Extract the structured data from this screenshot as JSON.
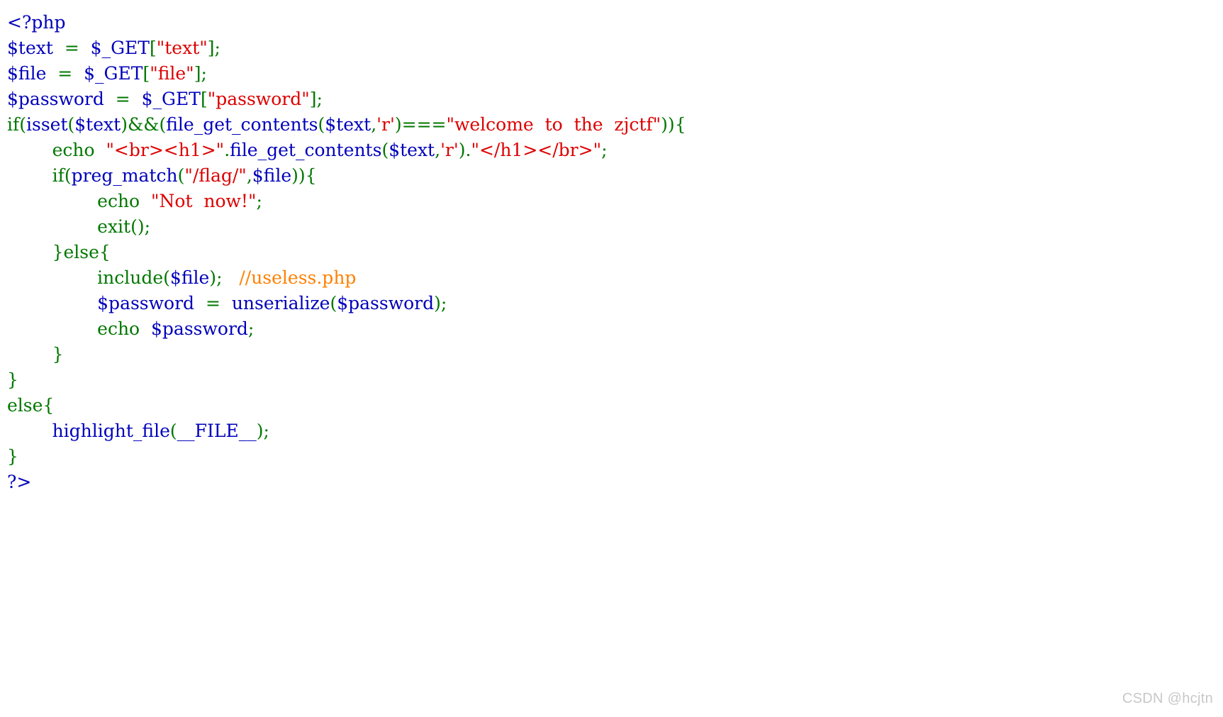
{
  "page": {
    "background_color": "#ffffff",
    "kind": "php-highlight-file-output"
  },
  "palette": {
    "default": "#0000BB",
    "keyword": "#007700",
    "string": "#DD0000",
    "comment": "#FF8000",
    "html": "#000000",
    "watermark": "#c8c8c8"
  },
  "code": {
    "language": "php",
    "lines": [
      {
        "index": 1,
        "text": "<?php",
        "tokens": [
          {
            "t": "<?php",
            "c": "default"
          }
        ]
      },
      {
        "index": 2,
        "text": "$text  =  $_GET[\"text\"];",
        "tokens": [
          {
            "t": "$text",
            "c": "default"
          },
          {
            "t": "  ",
            "c": "default"
          },
          {
            "t": "=",
            "c": "keyword"
          },
          {
            "t": "  ",
            "c": "default"
          },
          {
            "t": "$_GET",
            "c": "default"
          },
          {
            "t": "[",
            "c": "keyword"
          },
          {
            "t": "\"text\"",
            "c": "string"
          },
          {
            "t": "]",
            "c": "keyword"
          },
          {
            "t": ";",
            "c": "keyword"
          }
        ]
      },
      {
        "index": 3,
        "text": "$file  =  $_GET[\"file\"];",
        "tokens": [
          {
            "t": "$file",
            "c": "default"
          },
          {
            "t": "  ",
            "c": "default"
          },
          {
            "t": "=",
            "c": "keyword"
          },
          {
            "t": "  ",
            "c": "default"
          },
          {
            "t": "$_GET",
            "c": "default"
          },
          {
            "t": "[",
            "c": "keyword"
          },
          {
            "t": "\"file\"",
            "c": "string"
          },
          {
            "t": "]",
            "c": "keyword"
          },
          {
            "t": ";",
            "c": "keyword"
          }
        ]
      },
      {
        "index": 4,
        "text": "$password  =  $_GET[\"password\"];",
        "tokens": [
          {
            "t": "$password",
            "c": "default"
          },
          {
            "t": "  ",
            "c": "default"
          },
          {
            "t": "=",
            "c": "keyword"
          },
          {
            "t": "  ",
            "c": "default"
          },
          {
            "t": "$_GET",
            "c": "default"
          },
          {
            "t": "[",
            "c": "keyword"
          },
          {
            "t": "\"password\"",
            "c": "string"
          },
          {
            "t": "]",
            "c": "keyword"
          },
          {
            "t": ";",
            "c": "keyword"
          }
        ]
      },
      {
        "index": 5,
        "text": "if(isset($text)&&(file_get_contents($text,'r')===\"welcome  to  the  zjctf\")){",
        "tokens": [
          {
            "t": "if",
            "c": "keyword"
          },
          {
            "t": "(",
            "c": "keyword"
          },
          {
            "t": "isset",
            "c": "default"
          },
          {
            "t": "(",
            "c": "keyword"
          },
          {
            "t": "$text",
            "c": "default"
          },
          {
            "t": ")",
            "c": "keyword"
          },
          {
            "t": "&&",
            "c": "keyword"
          },
          {
            "t": "(",
            "c": "keyword"
          },
          {
            "t": "file_get_contents",
            "c": "default"
          },
          {
            "t": "(",
            "c": "keyword"
          },
          {
            "t": "$text",
            "c": "default"
          },
          {
            "t": ",",
            "c": "keyword"
          },
          {
            "t": "'r'",
            "c": "string"
          },
          {
            "t": ")",
            "c": "keyword"
          },
          {
            "t": "===",
            "c": "keyword"
          },
          {
            "t": "\"welcome  to  the  zjctf\"",
            "c": "string"
          },
          {
            "t": ")",
            "c": "keyword"
          },
          {
            "t": ")",
            "c": "keyword"
          },
          {
            "t": "{",
            "c": "keyword"
          }
        ]
      },
      {
        "index": 6,
        "text": "        echo  \"<br><h1>\".file_get_contents($text,'r').\"</h1></br>\";",
        "tokens": [
          {
            "t": "        ",
            "c": "default"
          },
          {
            "t": "echo",
            "c": "keyword"
          },
          {
            "t": "  ",
            "c": "default"
          },
          {
            "t": "\"<br><h1>\"",
            "c": "string"
          },
          {
            "t": ".",
            "c": "keyword"
          },
          {
            "t": "file_get_contents",
            "c": "default"
          },
          {
            "t": "(",
            "c": "keyword"
          },
          {
            "t": "$text",
            "c": "default"
          },
          {
            "t": ",",
            "c": "keyword"
          },
          {
            "t": "'r'",
            "c": "string"
          },
          {
            "t": ")",
            "c": "keyword"
          },
          {
            "t": ".",
            "c": "keyword"
          },
          {
            "t": "\"</h1></br>\"",
            "c": "string"
          },
          {
            "t": ";",
            "c": "keyword"
          }
        ]
      },
      {
        "index": 7,
        "text": "        if(preg_match(\"/flag/\",$file)){",
        "tokens": [
          {
            "t": "        ",
            "c": "default"
          },
          {
            "t": "if",
            "c": "keyword"
          },
          {
            "t": "(",
            "c": "keyword"
          },
          {
            "t": "preg_match",
            "c": "default"
          },
          {
            "t": "(",
            "c": "keyword"
          },
          {
            "t": "\"/flag/\"",
            "c": "string"
          },
          {
            "t": ",",
            "c": "keyword"
          },
          {
            "t": "$file",
            "c": "default"
          },
          {
            "t": ")",
            "c": "keyword"
          },
          {
            "t": ")",
            "c": "keyword"
          },
          {
            "t": "{",
            "c": "keyword"
          }
        ]
      },
      {
        "index": 8,
        "text": "                echo  \"Not  now!\";",
        "tokens": [
          {
            "t": "                ",
            "c": "default"
          },
          {
            "t": "echo",
            "c": "keyword"
          },
          {
            "t": "  ",
            "c": "default"
          },
          {
            "t": "\"Not  now!\"",
            "c": "string"
          },
          {
            "t": ";",
            "c": "keyword"
          }
        ]
      },
      {
        "index": 9,
        "text": "                exit();",
        "tokens": [
          {
            "t": "                ",
            "c": "default"
          },
          {
            "t": "exit",
            "c": "keyword"
          },
          {
            "t": "(",
            "c": "keyword"
          },
          {
            "t": ")",
            "c": "keyword"
          },
          {
            "t": ";",
            "c": "keyword"
          }
        ]
      },
      {
        "index": 10,
        "text": "        }else{",
        "tokens": [
          {
            "t": "        ",
            "c": "default"
          },
          {
            "t": "}",
            "c": "keyword"
          },
          {
            "t": "else",
            "c": "keyword"
          },
          {
            "t": "{",
            "c": "keyword"
          }
        ]
      },
      {
        "index": 11,
        "text": "                include($file);   //useless.php",
        "tokens": [
          {
            "t": "                ",
            "c": "default"
          },
          {
            "t": "include",
            "c": "keyword"
          },
          {
            "t": "(",
            "c": "keyword"
          },
          {
            "t": "$file",
            "c": "default"
          },
          {
            "t": ")",
            "c": "keyword"
          },
          {
            "t": ";",
            "c": "keyword"
          },
          {
            "t": "   ",
            "c": "default"
          },
          {
            "t": "//useless.php",
            "c": "comment"
          }
        ]
      },
      {
        "index": 12,
        "text": "                $password  =  unserialize($password);",
        "tokens": [
          {
            "t": "                ",
            "c": "default"
          },
          {
            "t": "$password",
            "c": "default"
          },
          {
            "t": "  ",
            "c": "default"
          },
          {
            "t": "=",
            "c": "keyword"
          },
          {
            "t": "  ",
            "c": "default"
          },
          {
            "t": "unserialize",
            "c": "default"
          },
          {
            "t": "(",
            "c": "keyword"
          },
          {
            "t": "$password",
            "c": "default"
          },
          {
            "t": ")",
            "c": "keyword"
          },
          {
            "t": ";",
            "c": "keyword"
          }
        ]
      },
      {
        "index": 13,
        "text": "                echo  $password;",
        "tokens": [
          {
            "t": "                ",
            "c": "default"
          },
          {
            "t": "echo",
            "c": "keyword"
          },
          {
            "t": "  ",
            "c": "default"
          },
          {
            "t": "$password",
            "c": "default"
          },
          {
            "t": ";",
            "c": "keyword"
          }
        ]
      },
      {
        "index": 14,
        "text": "        }",
        "tokens": [
          {
            "t": "        ",
            "c": "default"
          },
          {
            "t": "}",
            "c": "keyword"
          }
        ]
      },
      {
        "index": 15,
        "text": "}",
        "tokens": [
          {
            "t": "}",
            "c": "keyword"
          }
        ]
      },
      {
        "index": 16,
        "text": "else{",
        "tokens": [
          {
            "t": "else",
            "c": "keyword"
          },
          {
            "t": "{",
            "c": "keyword"
          }
        ]
      },
      {
        "index": 17,
        "text": "        highlight_file(__FILE__);",
        "tokens": [
          {
            "t": "        ",
            "c": "default"
          },
          {
            "t": "highlight_file",
            "c": "default"
          },
          {
            "t": "(",
            "c": "keyword"
          },
          {
            "t": "__FILE__",
            "c": "default"
          },
          {
            "t": ")",
            "c": "keyword"
          },
          {
            "t": ";",
            "c": "keyword"
          }
        ]
      },
      {
        "index": 18,
        "text": "}",
        "tokens": [
          {
            "t": "}",
            "c": "keyword"
          }
        ]
      },
      {
        "index": 19,
        "text": "?>",
        "tokens": [
          {
            "t": "?>",
            "c": "default"
          }
        ]
      }
    ]
  },
  "watermark": {
    "label": "CSDN @hcjtn"
  }
}
